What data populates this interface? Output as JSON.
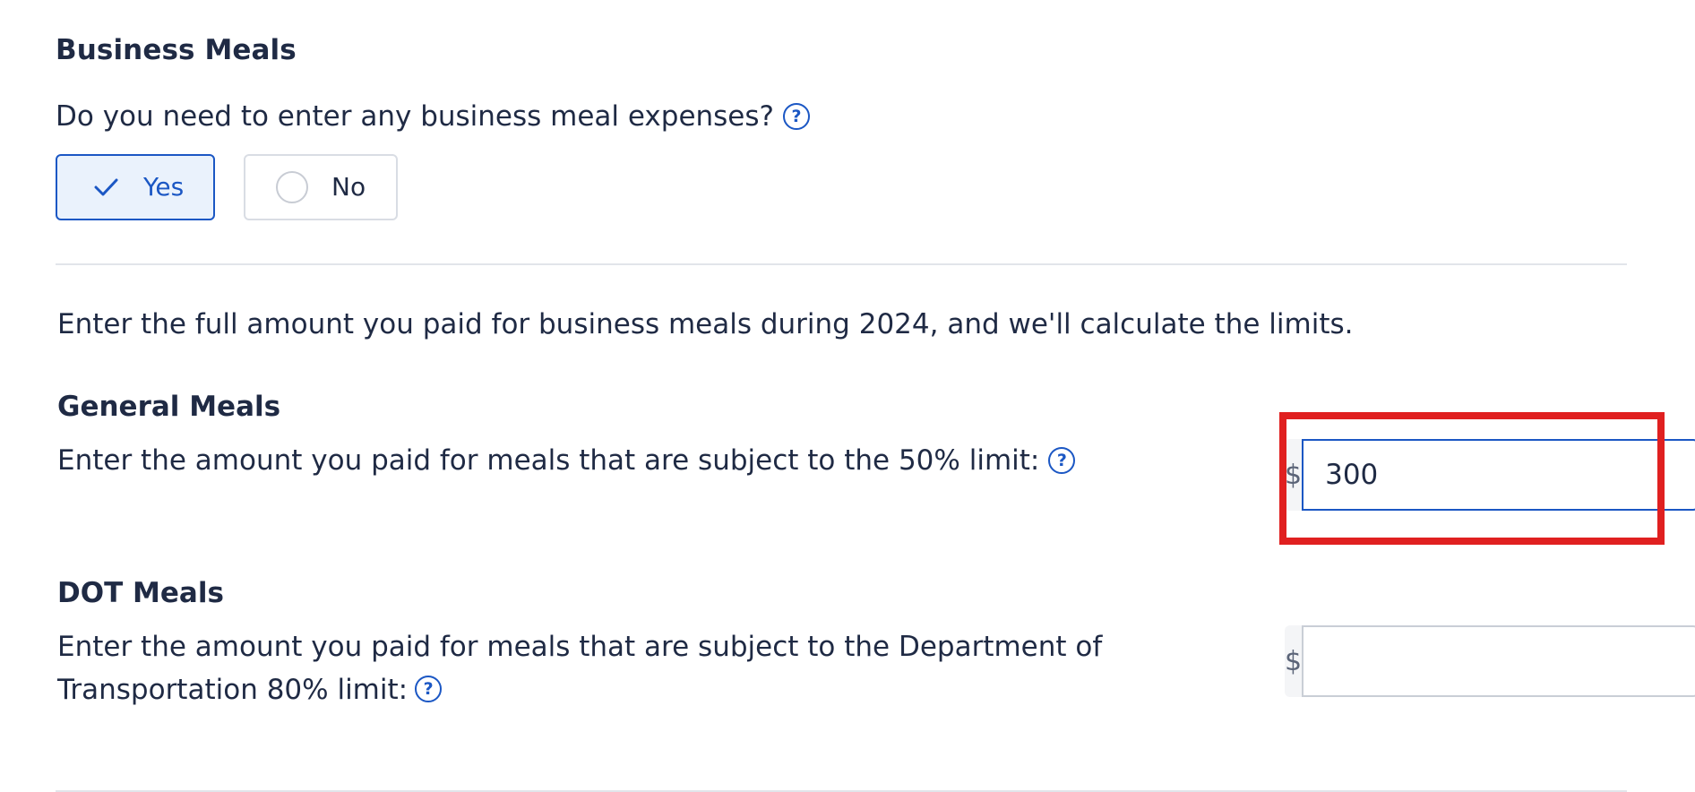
{
  "section": {
    "title": "Business Meals",
    "question": "Do you need to enter any business meal expenses?",
    "help_symbol": "?"
  },
  "choices": {
    "yes_label": "Yes",
    "no_label": "No",
    "selected": "Yes"
  },
  "instructions": "Enter the full amount you paid for business meals during 2024, and we'll calculate the limits.",
  "general_meals": {
    "title": "General Meals",
    "description": "Enter the amount you paid for meals that are subject to the 50% limit:",
    "help_symbol": "?",
    "currency_symbol": "$",
    "value": "300",
    "placeholder": ""
  },
  "dot_meals": {
    "title": "DOT Meals",
    "description": "Enter the amount you paid for meals that are subject to the Department of Transportation 80% limit:",
    "help_symbol": "?",
    "currency_symbol": "$",
    "value": "",
    "placeholder": ""
  },
  "icons": {
    "help": "question-circle-icon",
    "check": "checkmark-icon",
    "radio": "radio-empty-icon"
  },
  "colors": {
    "accent": "#1b57c4",
    "text": "#1f2a44",
    "highlight": "#e02020",
    "selected_bg": "#eaf2fc"
  }
}
